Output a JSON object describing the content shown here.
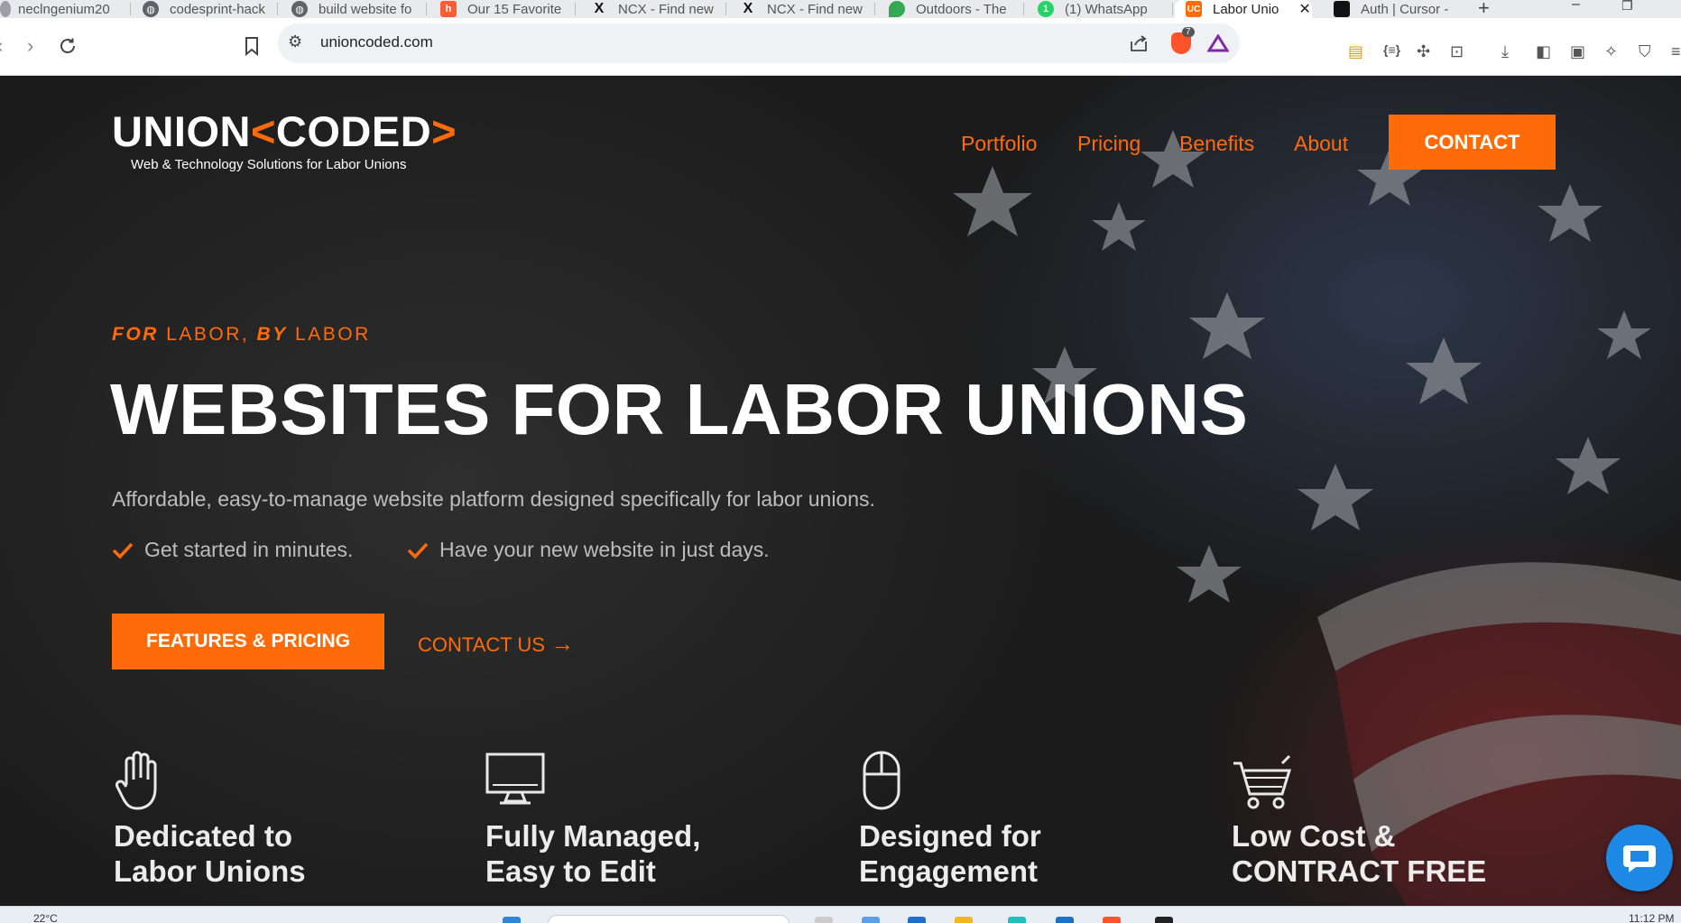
{
  "browser": {
    "tabs": [
      {
        "title": "neclngenium20",
        "icon": "tab-site-icon"
      },
      {
        "title": "codesprint-hack",
        "icon": "globe-icon"
      },
      {
        "title": "build website fo",
        "icon": "globe-icon"
      },
      {
        "title": "Our 15 Favorite",
        "icon": "hubspot-icon"
      },
      {
        "title": "NCX - Find new",
        "icon": "x-icon"
      },
      {
        "title": "NCX - Find new",
        "icon": "x-icon"
      },
      {
        "title": "Outdoors - The",
        "icon": "leaf-icon"
      },
      {
        "title": "(1) WhatsApp",
        "icon": "whatsapp-icon",
        "badge": "1"
      },
      {
        "title": "Labor Unio",
        "icon": "uc-icon",
        "fav_text": "UC",
        "active": true
      },
      {
        "title": "Auth | Cursor -",
        "icon": "cursor-icon"
      }
    ],
    "address": "unioncoded.com",
    "shields_count": "7"
  },
  "site": {
    "logo_word_left": "UNION",
    "logo_bracket_left": "<",
    "logo_word_right": "CODED",
    "logo_bracket_right": ">",
    "logo_tagline": "Web & Technology Solutions for Labor Unions",
    "nav": [
      "Portfolio",
      "Pricing",
      "Benefits",
      "About"
    ],
    "contact_button": "CONTACT"
  },
  "hero": {
    "eyebrow_a": "FOR",
    "eyebrow_b": " LABOR, ",
    "eyebrow_c": "BY",
    "eyebrow_d": " LABOR",
    "headline": "WEBSITES FOR LABOR UNIONS",
    "lede": "Affordable, easy-to-manage website platform designed specifically for labor unions.",
    "checks": [
      "Get started in minutes.",
      "Have your new website in just days."
    ],
    "cta_primary": "FEATURES & PRICING",
    "cta_secondary": "CONTACT US",
    "cta_secondary_arrow": "→"
  },
  "features": [
    {
      "icon": "hand-icon",
      "line1": "Dedicated to",
      "line2": "Labor Unions"
    },
    {
      "icon": "monitor-icon",
      "line1": "Fully Managed,",
      "line2": "Easy to Edit"
    },
    {
      "icon": "mouse-icon",
      "line1": "Designed for",
      "line2": "Engagement"
    },
    {
      "icon": "cart-icon",
      "line1": "Low Cost &",
      "line2": "CONTRACT FREE"
    }
  ],
  "taskbar": {
    "temperature": "22°C",
    "clock": "11:12 PM"
  },
  "colors": {
    "accent": "#ff6b09",
    "chat": "#1e88e5"
  }
}
